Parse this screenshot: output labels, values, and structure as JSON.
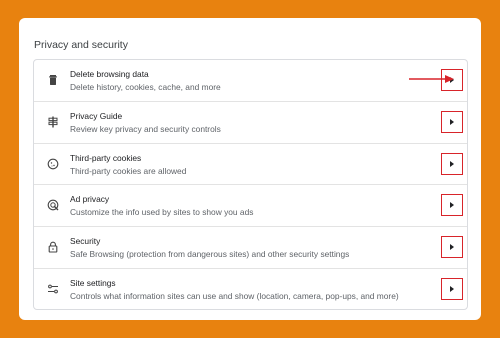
{
  "section": {
    "title": "Privacy and security"
  },
  "rows": [
    {
      "title": "Delete browsing data",
      "desc": "Delete history, cookies, cache, and more",
      "icon": "trash-icon"
    },
    {
      "title": "Privacy Guide",
      "desc": "Review key privacy and security controls",
      "icon": "privacy-guide-icon"
    },
    {
      "title": "Third-party cookies",
      "desc": "Third-party cookies are allowed",
      "icon": "cookie-icon"
    },
    {
      "title": "Ad privacy",
      "desc": "Customize the info used by sites to show you ads",
      "icon": "ad-privacy-icon"
    },
    {
      "title": "Security",
      "desc": "Safe Browsing (protection from dangerous sites) and other security settings",
      "icon": "lock-icon"
    },
    {
      "title": "Site settings",
      "desc": "Controls what information sites can use and show (location, camera, pop-ups, and more)",
      "icon": "sliders-icon"
    }
  ],
  "colors": {
    "background": "#e8820f",
    "highlight": "#d8242a"
  }
}
